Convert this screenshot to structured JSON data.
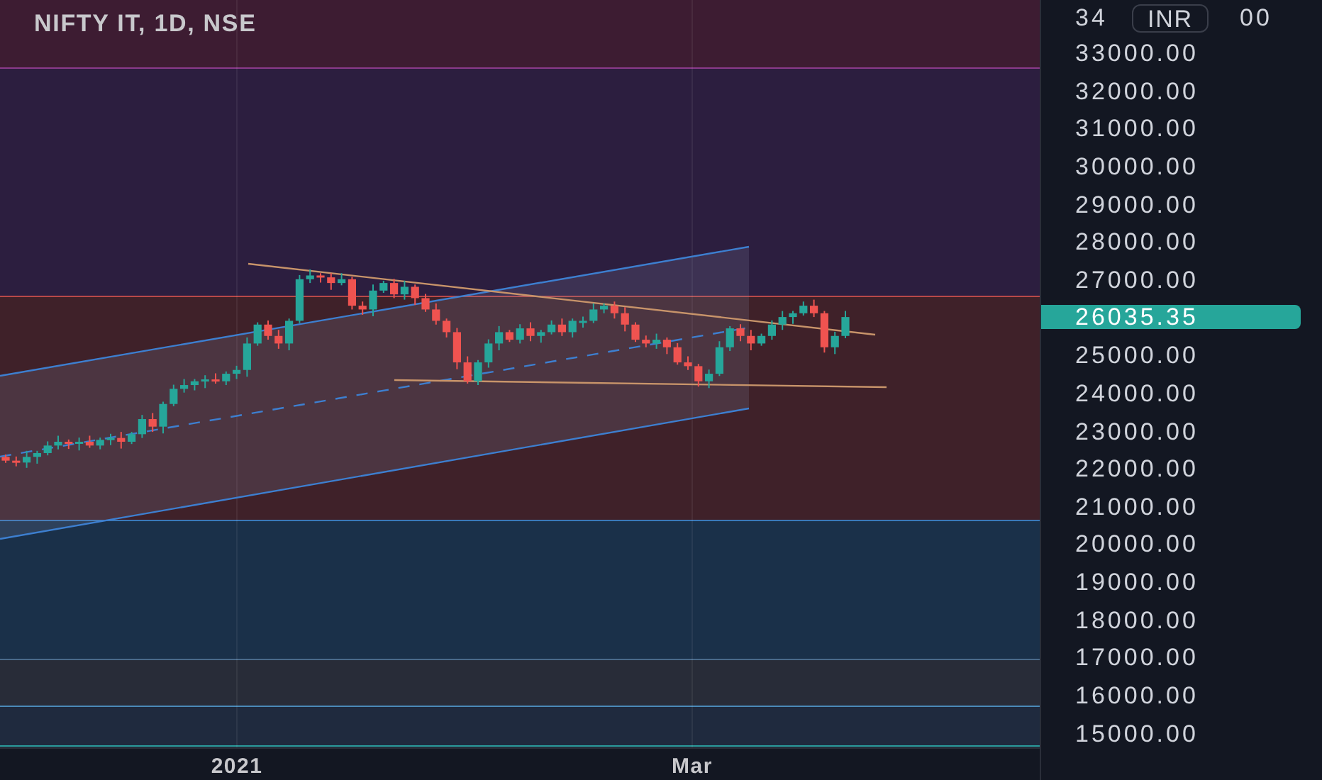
{
  "chart_title": "NIFTY IT, 1D, NSE",
  "price_axis": {
    "top_label_parts": [
      "34",
      "00"
    ],
    "currency_badge": "INR",
    "labels": [
      "33000.00",
      "32000.00",
      "31000.00",
      "30000.00",
      "29000.00",
      "28000.00",
      "27000.00",
      "25000.00",
      "24000.00",
      "23000.00",
      "22000.00",
      "21000.00",
      "20000.00",
      "19000.00",
      "18000.00",
      "17000.00",
      "16000.00",
      "15000.00"
    ],
    "current_price": "26035.35"
  },
  "time_axis": {
    "labels": [
      "2021",
      "Mar"
    ]
  }
}
